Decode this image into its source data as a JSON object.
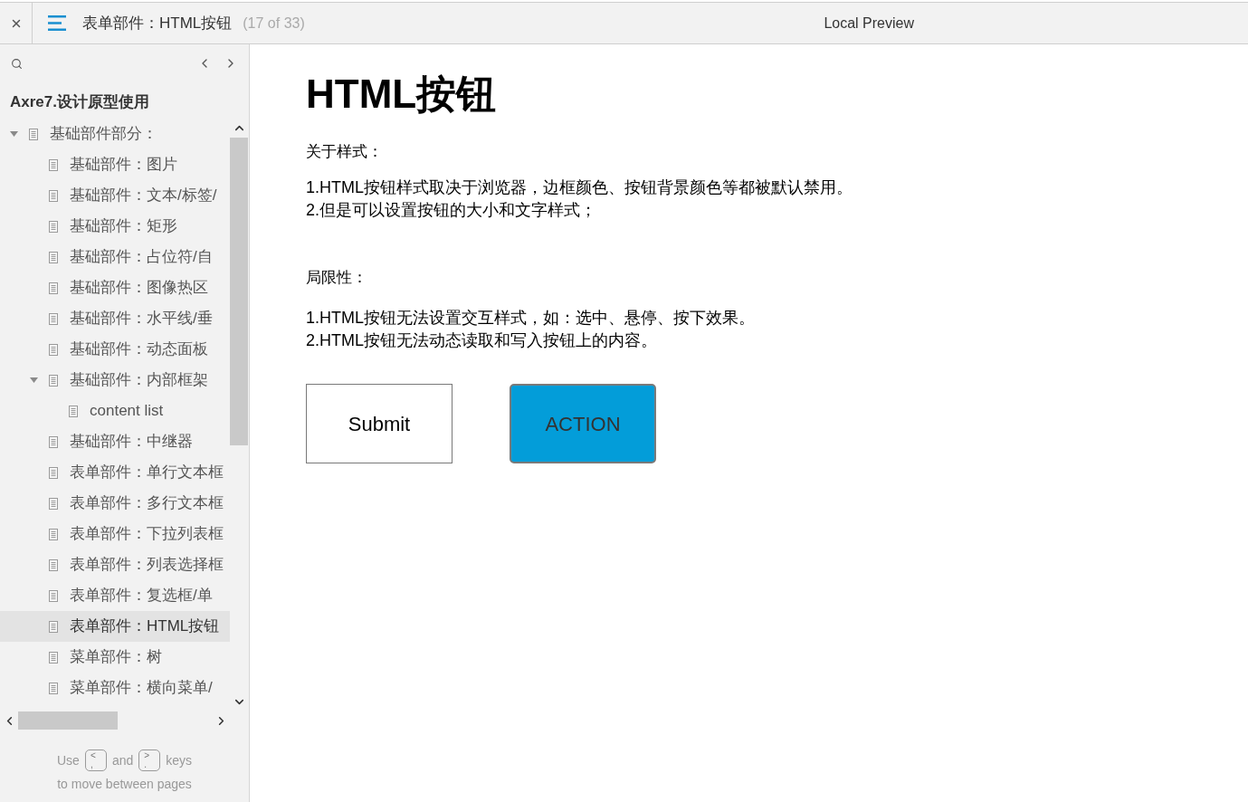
{
  "top_bar": {
    "title": "表单部件：HTML按钮",
    "page_count": "(17 of 33)",
    "preview_label": "Local Preview"
  },
  "sidebar": {
    "project_title": "Axre7.设计原型使用",
    "tree": [
      {
        "label": "基础部件部分：",
        "expanded": true,
        "selected": false,
        "children": [
          {
            "label": "基础部件：图片",
            "selected": false
          },
          {
            "label": "基础部件：文本/标签/",
            "selected": false
          },
          {
            "label": "基础部件：矩形",
            "selected": false
          },
          {
            "label": "基础部件：占位符/自",
            "selected": false
          },
          {
            "label": "基础部件：图像热区",
            "selected": false
          },
          {
            "label": "基础部件：水平线/垂",
            "selected": false
          },
          {
            "label": "基础部件：动态面板",
            "selected": false
          },
          {
            "label": "基础部件：内部框架",
            "expanded": true,
            "selected": false,
            "children": [
              {
                "label": "content list",
                "selected": false
              }
            ]
          },
          {
            "label": "基础部件：中继器",
            "selected": false
          },
          {
            "label": "表单部件：单行文本框",
            "selected": false
          },
          {
            "label": "表单部件：多行文本框",
            "selected": false
          },
          {
            "label": "表单部件：下拉列表框",
            "selected": false
          },
          {
            "label": "表单部件：列表选择框",
            "selected": false
          },
          {
            "label": "表单部件：复选框/单",
            "selected": false
          },
          {
            "label": "表单部件：HTML按钮",
            "selected": true
          },
          {
            "label": "菜单部件：树",
            "selected": false
          },
          {
            "label": "菜单部件：横向菜单/",
            "selected": false
          }
        ]
      }
    ],
    "hint_line": [
      {
        "kind": "text",
        "text": "Use"
      },
      {
        "kind": "key",
        "top": "<",
        "bottom": ","
      },
      {
        "kind": "text",
        "text": "and"
      },
      {
        "kind": "key",
        "top": ">",
        "bottom": "."
      },
      {
        "kind": "text",
        "text": "keys"
      }
    ],
    "hint_second_line": "to move between pages"
  },
  "page": {
    "heading": "HTML按钮",
    "sections": [
      {
        "title": "关于样式：",
        "lines": [
          "1.HTML按钮样式取决于浏览器，边框颜色、按钮背景颜色等都被默认禁用。",
          "2.但是可以设置按钮的大小和文字样式；"
        ]
      },
      {
        "title": "局限性：",
        "lines": [
          "1.HTML按钮无法设置交互样式，如：选中、悬停、按下效果。",
          "2.HTML按钮无法动态读取和写入按钮上的内容。"
        ]
      }
    ],
    "buttons": [
      {
        "label": "Submit",
        "kind": "plain"
      },
      {
        "label": "ACTION",
        "kind": "filled"
      }
    ]
  }
}
